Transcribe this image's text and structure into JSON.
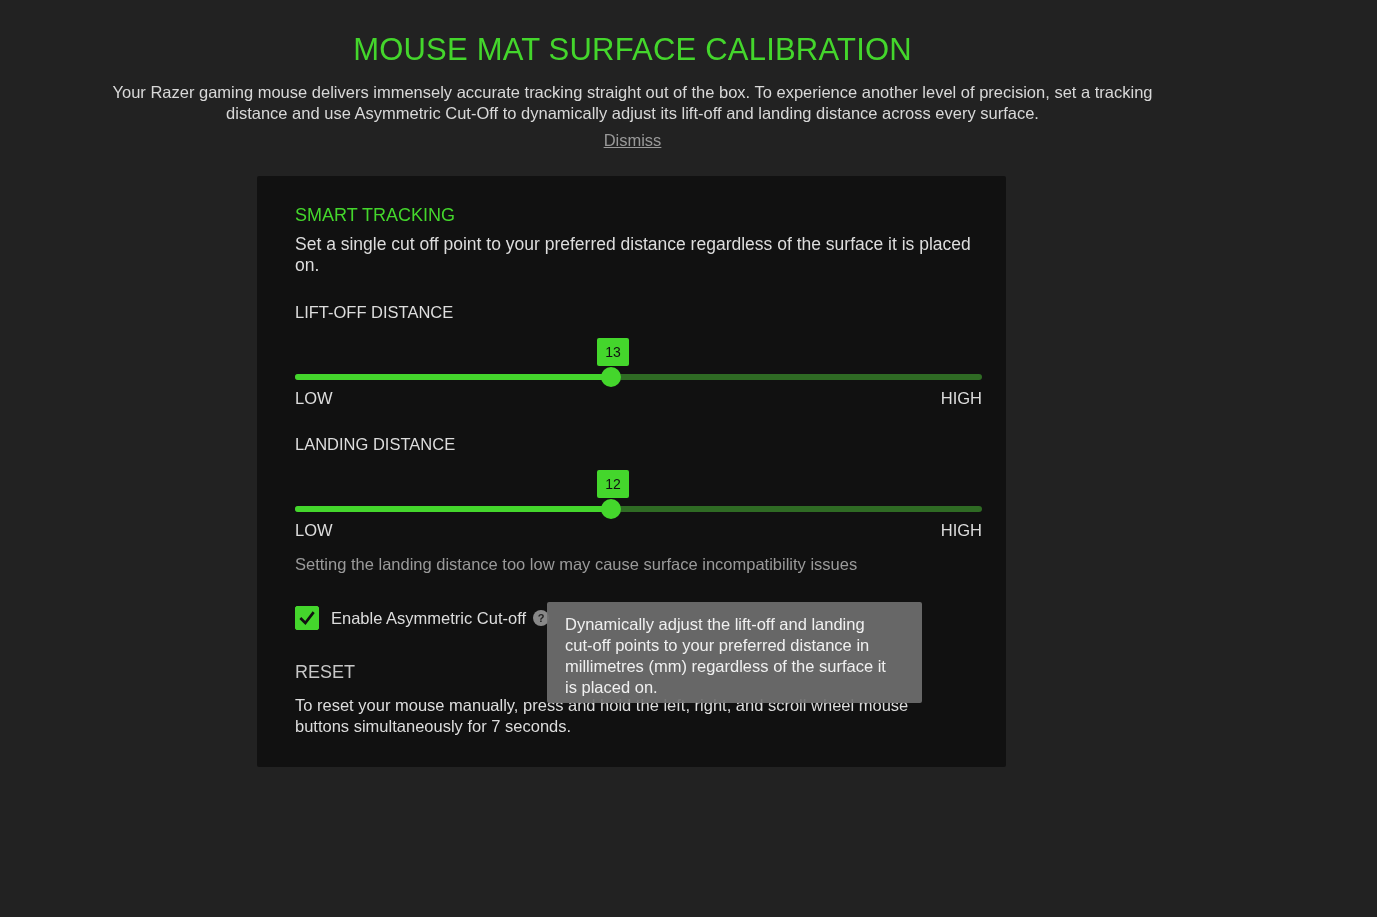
{
  "title": "MOUSE MAT SURFACE CALIBRATION",
  "intro": "Your Razer gaming mouse delivers immensely accurate tracking straight out of the box. To experience another level of precision, set a tracking distance and use Asymmetric Cut-Off to dynamically adjust its lift-off and landing distance across every surface.",
  "dismiss": "Dismiss",
  "card": {
    "heading": "SMART TRACKING",
    "description": "Set a single cut off point to your preferred distance regardless of the surface it is placed on.",
    "sliders": [
      {
        "label": "LIFT-OFF DISTANCE",
        "value": "13",
        "level": 0.46,
        "low": "LOW",
        "high": "HIGH"
      },
      {
        "label": "LANDING DISTANCE",
        "value": "12",
        "level": 0.46,
        "low": "LOW",
        "high": "HIGH"
      }
    ],
    "warning": "Setting the landing distance too low may cause surface incompatibility issues",
    "asymmetric": {
      "label": "Enable Asymmetric Cut-off",
      "checked": true,
      "help": "?",
      "tooltip": "Dynamically adjust the lift-off and landing cut-off points to your preferred distance in millimetres (mm) regardless of the surface it is placed on."
    },
    "reset_heading": "RESET",
    "reset_text": "To reset your mouse manually, press and hold the left, right, and scroll wheel mouse buttons simultaneously for 7 seconds."
  }
}
